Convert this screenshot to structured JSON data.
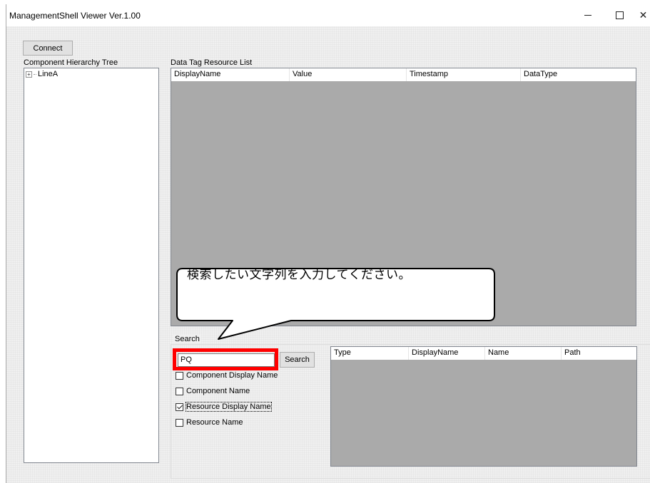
{
  "window": {
    "title": "ManagementShell Viewer Ver.1.00",
    "controls": {
      "minimize_icon": "minimize-icon",
      "maximize_icon": "maximize-icon",
      "close_icon": "close-icon",
      "close_glyph": "✕"
    }
  },
  "toolbar": {
    "connect_label": "Connect"
  },
  "tree": {
    "label": "Component Hierarchy Tree",
    "nodes": [
      {
        "label": "LineA",
        "expander": "+"
      }
    ]
  },
  "data_tags": {
    "label": "Data Tag Resource List",
    "columns": [
      "DisplayName",
      "Value",
      "Timestamp",
      "DataType"
    ]
  },
  "search": {
    "label": "Search",
    "input_value": "PQ",
    "button_label": "Search",
    "options": [
      {
        "label": "Component Display Name",
        "checked": false
      },
      {
        "label": "Component Name",
        "checked": false
      },
      {
        "label": "Resource Display Name",
        "checked": true
      },
      {
        "label": "Resource Name",
        "checked": false
      }
    ],
    "result_columns": [
      "Type",
      "DisplayName",
      "Name",
      "Path"
    ]
  },
  "callout": {
    "text": "検索したい文字列を入力してください。"
  },
  "colors": {
    "highlight": "#ff0000",
    "list_background": "#aaaaaa"
  }
}
